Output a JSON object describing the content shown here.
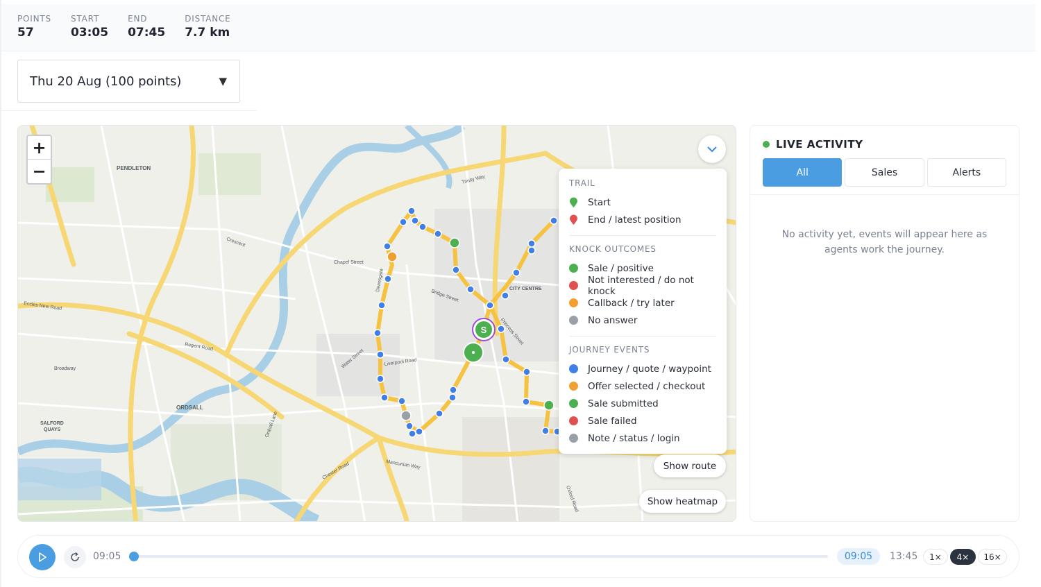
{
  "stats": {
    "points_label": "POINTS",
    "points_value": "57",
    "start_label": "START",
    "start_value": "03:05",
    "end_label": "END",
    "end_value": "07:45",
    "distance_label": "DISTANCE",
    "distance_value": "7.7 km"
  },
  "date_select": {
    "value": "Thu 20 Aug (100 points)",
    "caret": "▼"
  },
  "map": {
    "zoom_in": "+",
    "zoom_out": "−",
    "labels": {
      "pendleton": "PENDLETON",
      "ordsall": "ORDSALL",
      "salford_quays_1": "SALFORD",
      "salford_quays_2": "QUAYS",
      "city_centre": "CITY CENTRE",
      "chapel_street": "Chapel Street",
      "crescent": "Crescent",
      "regent_road": "Regent Road",
      "broadway": "Broadway",
      "eccles_new_road": "Eccles New Road",
      "bridge_street": "Bridge Street",
      "liverpool_road": "Liverpool Road",
      "mancunian_way": "Mancunian Way",
      "chester_road": "Chester Road",
      "trinity_way": "Trinity Way",
      "ordsall_lane": "Ordsall Lane",
      "oxford_road": "Oxford Road",
      "princess_street": "Princess Street",
      "water_street": "Water Street",
      "deansgate": "Deansgate"
    },
    "start_marker": "S",
    "legend": {
      "trail_title": "TRAIL",
      "trail": [
        {
          "label": "Start",
          "color": "#4caf50"
        },
        {
          "label": "End / latest position",
          "color": "#e05252"
        }
      ],
      "knock_title": "KNOCK OUTCOMES",
      "knock": [
        {
          "label": "Sale / positive",
          "color": "#4caf50"
        },
        {
          "label": "Not interested / do not knock",
          "color": "#e05252"
        },
        {
          "label": "Callback / try later",
          "color": "#f0a030"
        },
        {
          "label": "No answer",
          "color": "#9aa0a8"
        }
      ],
      "journey_title": "JOURNEY EVENTS",
      "journey": [
        {
          "label": "Journey / quote / waypoint",
          "color": "#3f7fe6"
        },
        {
          "label": "Offer selected / checkout",
          "color": "#f0a030"
        },
        {
          "label": "Sale submitted",
          "color": "#4caf50"
        },
        {
          "label": "Sale failed",
          "color": "#e05252"
        },
        {
          "label": "Note / status / login",
          "color": "#9aa0a8"
        }
      ]
    },
    "show_route": "Show route",
    "show_heatmap": "Show heatmap"
  },
  "activity": {
    "title": "LIVE ACTIVITY",
    "tabs": [
      "All",
      "Sales",
      "Alerts"
    ],
    "active_tab": "All",
    "empty_message": "No activity yet, events will appear here as agents work the journey."
  },
  "player": {
    "start_time": "09:05",
    "current_time": "09:05",
    "end_time": "13:45",
    "speeds": [
      "1×",
      "4×",
      "16×"
    ],
    "active_speed": "4×",
    "progress": 0
  },
  "colors": {
    "accent": "#4a9de0",
    "route": "#f5c242",
    "waypoint": "#3f7fe6"
  }
}
